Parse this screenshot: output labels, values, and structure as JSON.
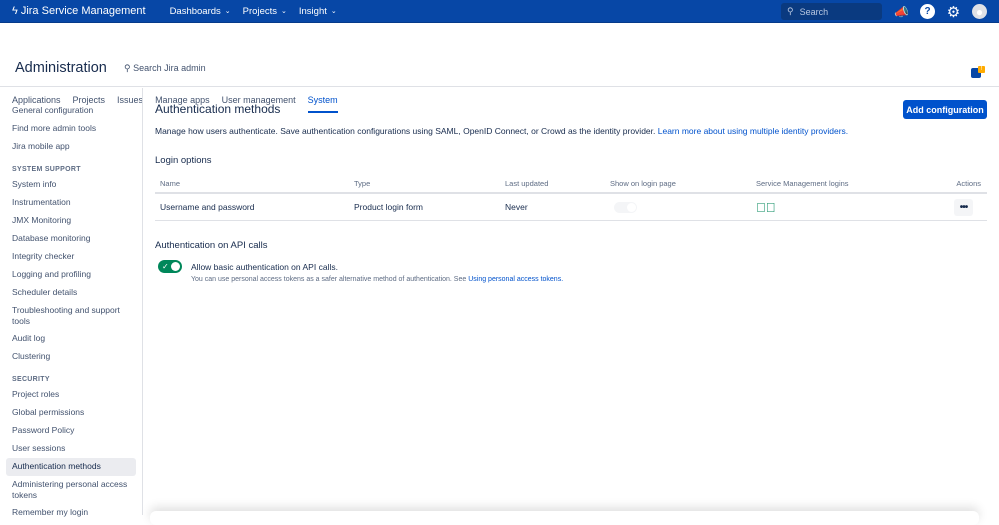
{
  "topbar": {
    "product": "Jira Service Management",
    "nav": [
      "Dashboards",
      "Projects",
      "Insight"
    ],
    "search_placeholder": "Search"
  },
  "header": {
    "title": "Administration",
    "search": "Search Jira admin",
    "tabs": [
      "Applications",
      "Projects",
      "Issues",
      "Manage apps",
      "User management",
      "System"
    ],
    "active_tab": "System",
    "feedback_badge": "!"
  },
  "sidebar": {
    "top": [
      "General configuration",
      "Find more admin tools",
      "Jira mobile app"
    ],
    "system_support_heading": "SYSTEM SUPPORT",
    "system_support": [
      "System info",
      "Instrumentation",
      "JMX Monitoring",
      "Database monitoring",
      "Integrity checker",
      "Logging and profiling",
      "Scheduler details",
      "Troubleshooting and support tools",
      "Audit log",
      "Clustering"
    ],
    "security_heading": "SECURITY",
    "security": [
      "Project roles",
      "Global permissions",
      "Password Policy",
      "User sessions",
      "Authentication methods",
      "Administering personal access tokens",
      "Remember my login"
    ],
    "selected": "Authentication methods"
  },
  "main": {
    "title": "Authentication methods",
    "add_button": "Add configuration",
    "description": "Manage how users authenticate. Save authentication configurations using SAML, OpenID Connect, or Crowd as the identity provider.",
    "description_link": "Learn more about using multiple identity providers.",
    "login_options": "Login options",
    "columns": [
      "Name",
      "Type",
      "Last updated",
      "Show on login page",
      "Service Management logins",
      "Actions"
    ],
    "rows": [
      {
        "name": "Username and password",
        "type": "Product login form",
        "last_updated": "Never",
        "show_on_login_page": false,
        "sm_logins": true,
        "actions": "•••"
      }
    ],
    "api_heading": "Authentication on API calls",
    "api_toggle": true,
    "api_label": "Allow basic authentication on API calls.",
    "api_sub": "You can use personal access tokens as a safer alternative method of authentication. See",
    "api_link": "Using personal access tokens."
  }
}
